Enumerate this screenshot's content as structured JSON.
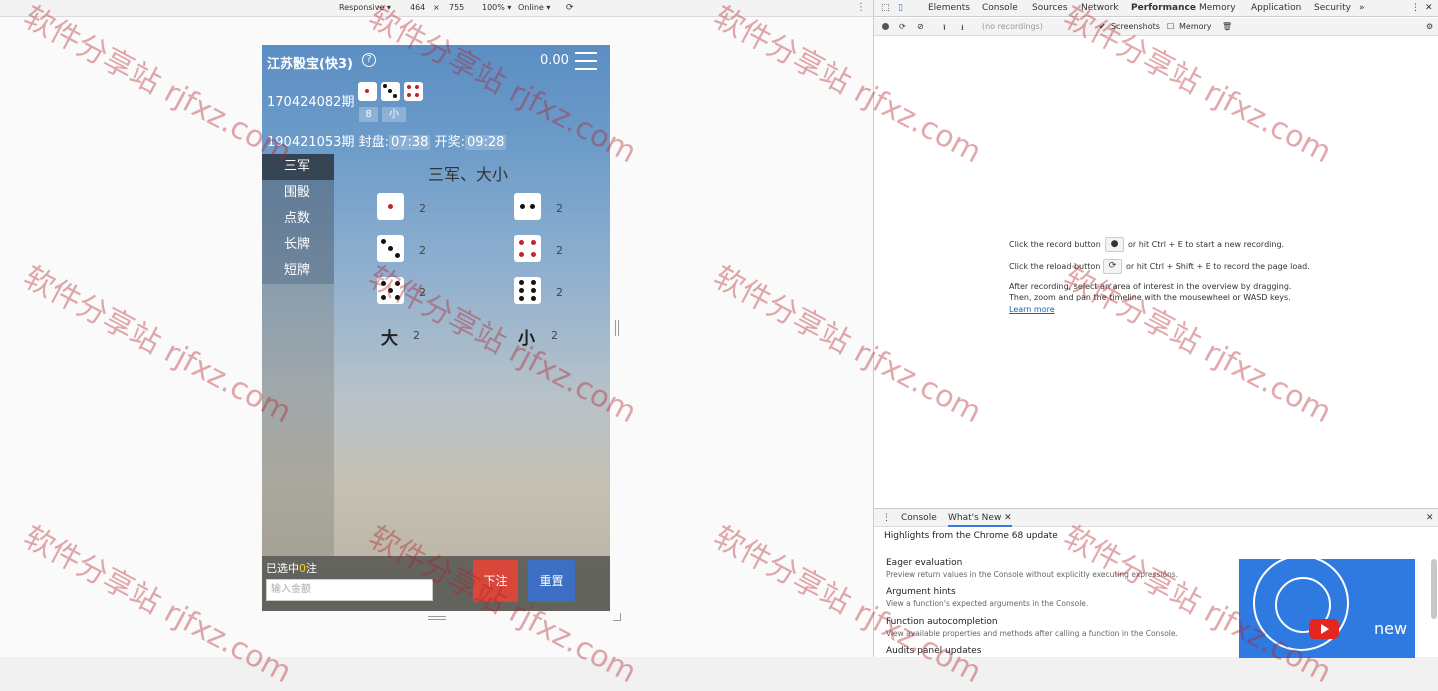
{
  "device_toolbar": {
    "device": "Responsive ▾",
    "width": "464",
    "times": "×",
    "height": "755",
    "zoom": "100% ▾",
    "network": "Online ▾"
  },
  "app": {
    "title": "江苏骰宝(快3)",
    "help": "?",
    "balance": "0.00",
    "last_issue": "170424082期",
    "last_dice": [
      1,
      3,
      4
    ],
    "last_sum": "8",
    "last_size": "小",
    "current_issue": "190421053期",
    "close_label": "封盘:",
    "close_time": "07:38",
    "open_label": "开奖:",
    "open_time": "09:28",
    "nav": [
      "三军",
      "围骰",
      "点数",
      "长牌",
      "短牌"
    ],
    "section_title": "三军、大小",
    "bets": [
      {
        "face": 1,
        "odds": "2"
      },
      {
        "face": 2,
        "odds": "2"
      },
      {
        "face": 3,
        "odds": "2"
      },
      {
        "face": 4,
        "odds": "2"
      },
      {
        "face": 5,
        "odds": "2"
      },
      {
        "face": 6,
        "odds": "2"
      }
    ],
    "big_label": "大",
    "big_odds": "2",
    "small_label": "小",
    "small_odds": "2",
    "selected_prefix": "已选中",
    "selected_count": "0",
    "selected_suffix": "注",
    "amount_placeholder": "输入金额",
    "bet_button": "下注",
    "reset_button": "重置"
  },
  "devtools": {
    "tabs": [
      "Elements",
      "Console",
      "Sources",
      "Network",
      "Performance",
      "Memory",
      "Application",
      "Security"
    ],
    "active_tab": "Performance",
    "more": "»",
    "close": "✕",
    "perf_toolbar": {
      "recordings": "(no recordings)",
      "screenshots": "Screenshots",
      "memory": "Memory"
    },
    "msg_record_pre": "Click the record button",
    "msg_record_post": "or hit Ctrl + E to start a new recording.",
    "msg_reload_pre": "Click the reload button",
    "msg_reload_post": "or hit Ctrl + Shift + E to record the page load.",
    "msg_after1": "After recording, select an area of interest in the overview by dragging.",
    "msg_after2": "Then, zoom and pan the timeline with the mousewheel or WASD keys.",
    "learn_more": "Learn more",
    "drawer": {
      "tab_console": "Console",
      "tab_whats_new": "What's New ✕",
      "highlights": "Highlights from the Chrome 68 update",
      "features": [
        {
          "title": "Eager evaluation",
          "desc": "Preview return values in the Console without explicitly executing expressions."
        },
        {
          "title": "Argument hints",
          "desc": "View a function's expected arguments in the Console."
        },
        {
          "title": "Function autocompletion",
          "desc": "View available properties and methods after calling a function in the Console."
        },
        {
          "title": "Audits panel updates",
          "desc": ""
        }
      ],
      "promo_new": "new"
    }
  },
  "watermark": {
    "text": "软件分享站 rjfxz.com"
  }
}
